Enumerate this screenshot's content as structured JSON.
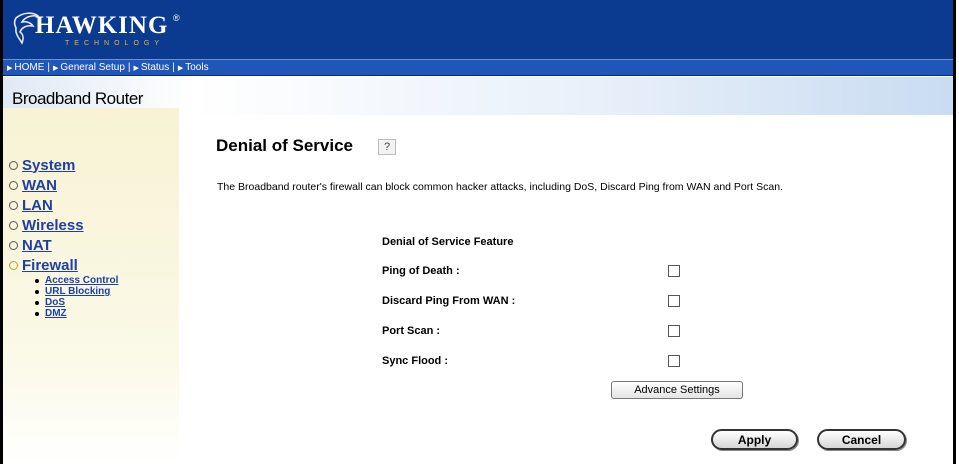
{
  "brand": {
    "name": "HAWKING",
    "tagline": "TECHNOLOGY",
    "registered": "®"
  },
  "nav": {
    "items": [
      {
        "label": "HOME"
      },
      {
        "label": "General Setup"
      },
      {
        "label": "Status"
      },
      {
        "label": "Tools"
      }
    ]
  },
  "product": {
    "title": "Broadband Router"
  },
  "sidebar": {
    "items": [
      {
        "label": "System"
      },
      {
        "label": "WAN"
      },
      {
        "label": "LAN"
      },
      {
        "label": "Wireless"
      },
      {
        "label": "NAT"
      },
      {
        "label": "Firewall"
      }
    ],
    "subitems": [
      {
        "label": "Access Control"
      },
      {
        "label": "URL Blocking"
      },
      {
        "label": "DoS"
      },
      {
        "label": "DMZ"
      }
    ]
  },
  "main": {
    "title": "Denial of Service",
    "help": "?",
    "description": "The Broadband router's firewall can block common hacker attacks, including DoS, Discard Ping from WAN and Port Scan.",
    "feature_heading": "Denial of Service Feature",
    "options": [
      {
        "label": "Ping of Death :",
        "checked": false
      },
      {
        "label": "Discard Ping From WAN :",
        "checked": false
      },
      {
        "label": "Port Scan :",
        "checked": false
      },
      {
        "label": "Sync Flood :",
        "checked": false
      }
    ],
    "advance_label": "Advance Settings",
    "apply_label": "Apply",
    "cancel_label": "Cancel"
  },
  "colors": {
    "header_bg": "#0b3a91",
    "nav_bg": "#1f56b8",
    "sidebar_bg": "#f7f3d4",
    "link": "#1f3fa6",
    "logo_accent": "#f0b72b"
  }
}
